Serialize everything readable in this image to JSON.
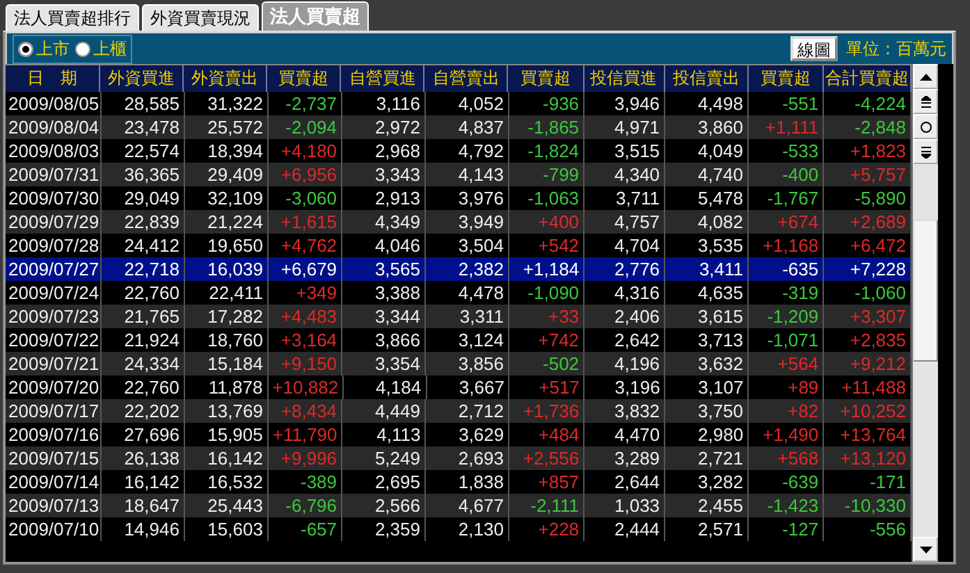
{
  "tabs": [
    {
      "label": "法人買賣超排行",
      "selected": false
    },
    {
      "label": "外資買賣現況",
      "selected": false
    },
    {
      "label": "法人買賣超",
      "selected": true
    }
  ],
  "markets": [
    {
      "label": "上市",
      "selected": true
    },
    {
      "label": "上櫃",
      "selected": false
    }
  ],
  "chart_button": "線圖",
  "unit": "單位：百萬元",
  "columns": [
    "日　期",
    "外資買進",
    "外資賣出",
    "買賣超",
    "自營買進",
    "自營賣出",
    "買賣超",
    "投信買進",
    "投信賣出",
    "買賣超",
    "合計買賣超"
  ],
  "rows": [
    {
      "date": "2009/08/05",
      "selected": false,
      "cells": [
        {
          "text": "28,585"
        },
        {
          "text": "31,322"
        },
        {
          "text": "-2,737",
          "rising": false
        },
        {
          "text": "3,116"
        },
        {
          "text": "4,052"
        },
        {
          "text": "-936",
          "rising": false
        },
        {
          "text": "3,946"
        },
        {
          "text": "4,498"
        },
        {
          "text": "-551",
          "rising": false
        },
        {
          "text": "-4,224",
          "rising": false
        }
      ]
    },
    {
      "date": "2009/08/04",
      "selected": false,
      "cells": [
        {
          "text": "23,478"
        },
        {
          "text": "25,572"
        },
        {
          "text": "-2,094",
          "rising": false
        },
        {
          "text": "2,972"
        },
        {
          "text": "4,837"
        },
        {
          "text": "-1,865",
          "rising": false
        },
        {
          "text": "4,971"
        },
        {
          "text": "3,860"
        },
        {
          "text": "+1,111",
          "rising": true
        },
        {
          "text": "-2,848",
          "rising": false
        }
      ]
    },
    {
      "date": "2009/08/03",
      "selected": false,
      "cells": [
        {
          "text": "22,574"
        },
        {
          "text": "18,394"
        },
        {
          "text": "+4,180",
          "rising": true
        },
        {
          "text": "2,968"
        },
        {
          "text": "4,792"
        },
        {
          "text": "-1,824",
          "rising": false
        },
        {
          "text": "3,515"
        },
        {
          "text": "4,049"
        },
        {
          "text": "-533",
          "rising": false
        },
        {
          "text": "+1,823",
          "rising": true
        }
      ]
    },
    {
      "date": "2009/07/31",
      "selected": false,
      "cells": [
        {
          "text": "36,365"
        },
        {
          "text": "29,409"
        },
        {
          "text": "+6,956",
          "rising": true
        },
        {
          "text": "3,343"
        },
        {
          "text": "4,143"
        },
        {
          "text": "-799",
          "rising": false
        },
        {
          "text": "4,340"
        },
        {
          "text": "4,740"
        },
        {
          "text": "-400",
          "rising": false
        },
        {
          "text": "+5,757",
          "rising": true
        }
      ]
    },
    {
      "date": "2009/07/30",
      "selected": false,
      "cells": [
        {
          "text": "29,049"
        },
        {
          "text": "32,109"
        },
        {
          "text": "-3,060",
          "rising": false
        },
        {
          "text": "2,913"
        },
        {
          "text": "3,976"
        },
        {
          "text": "-1,063",
          "rising": false
        },
        {
          "text": "3,711"
        },
        {
          "text": "5,478"
        },
        {
          "text": "-1,767",
          "rising": false
        },
        {
          "text": "-5,890",
          "rising": false
        }
      ]
    },
    {
      "date": "2009/07/29",
      "selected": false,
      "cells": [
        {
          "text": "22,839"
        },
        {
          "text": "21,224"
        },
        {
          "text": "+1,615",
          "rising": true
        },
        {
          "text": "4,349"
        },
        {
          "text": "3,949"
        },
        {
          "text": "+400",
          "rising": true
        },
        {
          "text": "4,757"
        },
        {
          "text": "4,082"
        },
        {
          "text": "+674",
          "rising": true
        },
        {
          "text": "+2,689",
          "rising": true
        }
      ]
    },
    {
      "date": "2009/07/28",
      "selected": false,
      "cells": [
        {
          "text": "24,412"
        },
        {
          "text": "19,650"
        },
        {
          "text": "+4,762",
          "rising": true
        },
        {
          "text": "4,046"
        },
        {
          "text": "3,504"
        },
        {
          "text": "+542",
          "rising": true
        },
        {
          "text": "4,704"
        },
        {
          "text": "3,535"
        },
        {
          "text": "+1,168",
          "rising": true
        },
        {
          "text": "+6,472",
          "rising": true
        }
      ]
    },
    {
      "date": "2009/07/27",
      "selected": true,
      "cells": [
        {
          "text": "22,718"
        },
        {
          "text": "16,039"
        },
        {
          "text": "+6,679"
        },
        {
          "text": "3,565"
        },
        {
          "text": "2,382"
        },
        {
          "text": "+1,184"
        },
        {
          "text": "2,776"
        },
        {
          "text": "3,411"
        },
        {
          "text": "-635"
        },
        {
          "text": "+7,228"
        }
      ]
    },
    {
      "date": "2009/07/24",
      "selected": false,
      "cells": [
        {
          "text": "22,760"
        },
        {
          "text": "22,411"
        },
        {
          "text": "+349",
          "rising": true
        },
        {
          "text": "3,388"
        },
        {
          "text": "4,478"
        },
        {
          "text": "-1,090",
          "rising": false
        },
        {
          "text": "4,316"
        },
        {
          "text": "4,635"
        },
        {
          "text": "-319",
          "rising": false
        },
        {
          "text": "-1,060",
          "rising": false
        }
      ]
    },
    {
      "date": "2009/07/23",
      "selected": false,
      "cells": [
        {
          "text": "21,765"
        },
        {
          "text": "17,282"
        },
        {
          "text": "+4,483",
          "rising": true
        },
        {
          "text": "3,344"
        },
        {
          "text": "3,311"
        },
        {
          "text": "+33",
          "rising": true
        },
        {
          "text": "2,406"
        },
        {
          "text": "3,615"
        },
        {
          "text": "-1,209",
          "rising": false
        },
        {
          "text": "+3,307",
          "rising": true
        }
      ]
    },
    {
      "date": "2009/07/22",
      "selected": false,
      "cells": [
        {
          "text": "21,924"
        },
        {
          "text": "18,760"
        },
        {
          "text": "+3,164",
          "rising": true
        },
        {
          "text": "3,866"
        },
        {
          "text": "3,124"
        },
        {
          "text": "+742",
          "rising": true
        },
        {
          "text": "2,642"
        },
        {
          "text": "3,713"
        },
        {
          "text": "-1,071",
          "rising": false
        },
        {
          "text": "+2,835",
          "rising": true
        }
      ]
    },
    {
      "date": "2009/07/21",
      "selected": false,
      "cells": [
        {
          "text": "24,334"
        },
        {
          "text": "15,184"
        },
        {
          "text": "+9,150",
          "rising": true
        },
        {
          "text": "3,354"
        },
        {
          "text": "3,856"
        },
        {
          "text": "-502",
          "rising": false
        },
        {
          "text": "4,196"
        },
        {
          "text": "3,632"
        },
        {
          "text": "+564",
          "rising": true
        },
        {
          "text": "+9,212",
          "rising": true
        }
      ]
    },
    {
      "date": "2009/07/20",
      "selected": false,
      "cells": [
        {
          "text": "22,760"
        },
        {
          "text": "11,878"
        },
        {
          "text": "+10,882",
          "rising": true
        },
        {
          "text": "4,184"
        },
        {
          "text": "3,667"
        },
        {
          "text": "+517",
          "rising": true
        },
        {
          "text": "3,196"
        },
        {
          "text": "3,107"
        },
        {
          "text": "+89",
          "rising": true
        },
        {
          "text": "+11,488",
          "rising": true
        }
      ]
    },
    {
      "date": "2009/07/17",
      "selected": false,
      "cells": [
        {
          "text": "22,202"
        },
        {
          "text": "13,769"
        },
        {
          "text": "+8,434",
          "rising": true
        },
        {
          "text": "4,449"
        },
        {
          "text": "2,712"
        },
        {
          "text": "+1,736",
          "rising": true
        },
        {
          "text": "3,832"
        },
        {
          "text": "3,750"
        },
        {
          "text": "+82",
          "rising": true
        },
        {
          "text": "+10,252",
          "rising": true
        }
      ]
    },
    {
      "date": "2009/07/16",
      "selected": false,
      "cells": [
        {
          "text": "27,696"
        },
        {
          "text": "15,905"
        },
        {
          "text": "+11,790",
          "rising": true
        },
        {
          "text": "4,113"
        },
        {
          "text": "3,629"
        },
        {
          "text": "+484",
          "rising": true
        },
        {
          "text": "4,470"
        },
        {
          "text": "2,980"
        },
        {
          "text": "+1,490",
          "rising": true
        },
        {
          "text": "+13,764",
          "rising": true
        }
      ]
    },
    {
      "date": "2009/07/15",
      "selected": false,
      "cells": [
        {
          "text": "26,138"
        },
        {
          "text": "16,142"
        },
        {
          "text": "+9,996",
          "rising": true
        },
        {
          "text": "5,249"
        },
        {
          "text": "2,693"
        },
        {
          "text": "+2,556",
          "rising": true
        },
        {
          "text": "3,289"
        },
        {
          "text": "2,721"
        },
        {
          "text": "+568",
          "rising": true
        },
        {
          "text": "+13,120",
          "rising": true
        }
      ]
    },
    {
      "date": "2009/07/14",
      "selected": false,
      "cells": [
        {
          "text": "16,142"
        },
        {
          "text": "16,532"
        },
        {
          "text": "-389",
          "rising": false
        },
        {
          "text": "2,695"
        },
        {
          "text": "1,838"
        },
        {
          "text": "+857",
          "rising": true
        },
        {
          "text": "2,644"
        },
        {
          "text": "3,282"
        },
        {
          "text": "-639",
          "rising": false
        },
        {
          "text": "-171",
          "rising": false
        }
      ]
    },
    {
      "date": "2009/07/13",
      "selected": false,
      "cells": [
        {
          "text": "18,647"
        },
        {
          "text": "25,443"
        },
        {
          "text": "-6,796",
          "rising": false
        },
        {
          "text": "2,566"
        },
        {
          "text": "4,677"
        },
        {
          "text": "-2,111",
          "rising": false
        },
        {
          "text": "1,033"
        },
        {
          "text": "2,455"
        },
        {
          "text": "-1,423",
          "rising": false
        },
        {
          "text": "-10,330",
          "rising": false
        }
      ]
    },
    {
      "date": "2009/07/10",
      "selected": false,
      "cells": [
        {
          "text": "14,946"
        },
        {
          "text": "15,603"
        },
        {
          "text": "-657",
          "rising": false
        },
        {
          "text": "2,359"
        },
        {
          "text": "2,130"
        },
        {
          "text": "+228",
          "rising": true
        },
        {
          "text": "2,444"
        },
        {
          "text": "2,571"
        },
        {
          "text": "-127",
          "rising": false
        },
        {
          "text": "-556",
          "rising": false
        }
      ]
    }
  ]
}
